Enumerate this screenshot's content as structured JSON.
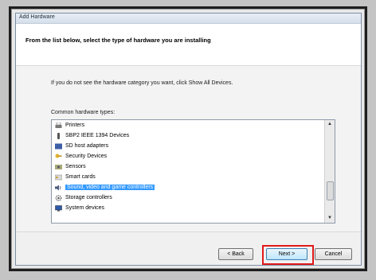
{
  "window": {
    "title": "Add Hardware"
  },
  "header": {
    "text": "From the list below, select the type of hardware you are installing"
  },
  "body": {
    "instruction": "If you do not see the hardware category you want, click Show All Devices.",
    "list_caption": "Common hardware types:"
  },
  "list": {
    "items": [
      {
        "label": "Printers",
        "icon": "printer-icon"
      },
      {
        "label": "SBP2 IEEE 1394 Devices",
        "icon": "device-icon"
      },
      {
        "label": "SD host adapters",
        "icon": "card-icon"
      },
      {
        "label": "Security Devices",
        "icon": "security-icon"
      },
      {
        "label": "Sensors",
        "icon": "sensor-icon"
      },
      {
        "label": "Smart cards",
        "icon": "smart-card-icon"
      },
      {
        "label": "Sound, video and game controllers",
        "icon": "speaker-icon",
        "selected": true
      },
      {
        "label": "Storage controllers",
        "icon": "gear-icon"
      },
      {
        "label": "System devices",
        "icon": "computer-icon"
      }
    ]
  },
  "buttons": {
    "back": "< Back",
    "next": "Next >",
    "cancel": "Cancel"
  },
  "colors": {
    "selection": "#3399ff",
    "highlight_box": "#e01a1a"
  }
}
